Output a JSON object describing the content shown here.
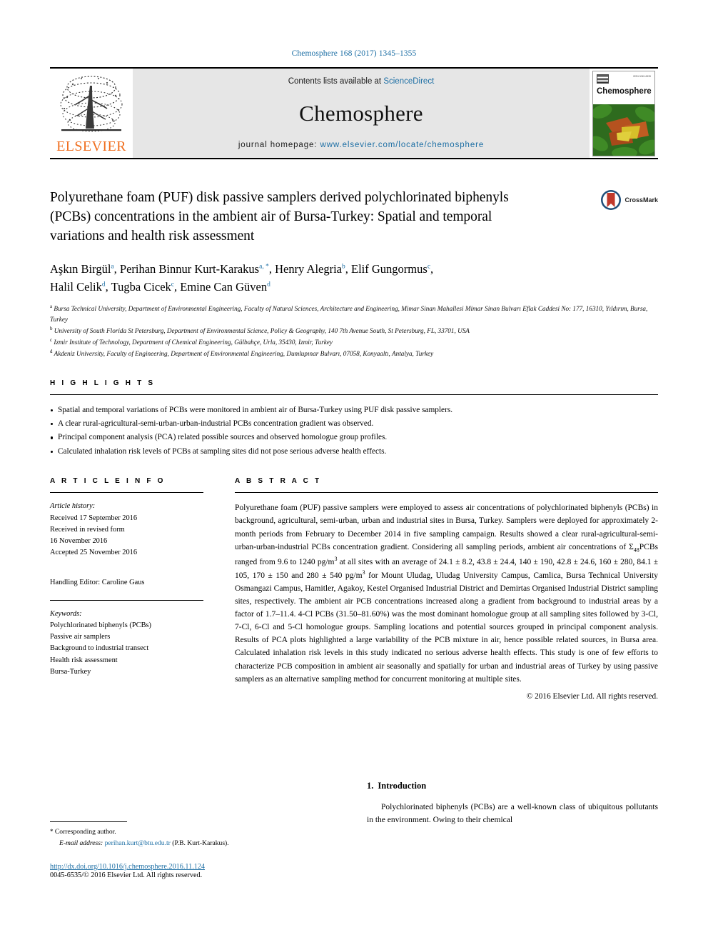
{
  "running_head": "Chemosphere 168 (2017) 1345–1355",
  "banner": {
    "publisher": "ELSEVIER",
    "contents_prefix": "Contents lists available at ",
    "sciencedirect": "ScienceDirect",
    "journal_name": "Chemosphere",
    "homepage_prefix": "journal homepage: ",
    "homepage_url": "www.elsevier.com/locate/chemosphere",
    "cover_title": "Chemosphere",
    "link_color": "#1c6ea4",
    "elsevier_orange": "#f06e1e"
  },
  "article": {
    "title": "Polyurethane foam (PUF) disk passive samplers derived polychlorinated biphenyls (PCBs) concentrations in the ambient air of Bursa-Turkey: Spatial and temporal variations and health risk assessment",
    "crossmark_label": "CrossMark",
    "authors_line1_parts": [
      {
        "name": "Aşkın Birgül",
        "sup": "a"
      },
      {
        "name": "Perihan Binnur Kurt-Karakus",
        "sup": "a, *"
      },
      {
        "name": "Henry Alegria",
        "sup": "b"
      },
      {
        "name": "Elif Gungormus",
        "sup": "c"
      }
    ],
    "authors_line2_parts": [
      {
        "name": "Halil Celik",
        "sup": "d"
      },
      {
        "name": "Tugba Cicek",
        "sup": "c"
      },
      {
        "name": "Emine Can Güven",
        "sup": "d"
      }
    ],
    "affiliations": [
      {
        "sup": "a",
        "text": "Bursa Technical University, Department of Environmental Engineering, Faculty of Natural Sciences, Architecture and Engineering, Mimar Sinan Mahallesi Mimar Sinan Bulvarı Eflak Caddesi No: 177, 16310, Yıldırım, Bursa, Turkey"
      },
      {
        "sup": "b",
        "text": "University of South Florida St Petersburg, Department of Environmental Science, Policy & Geography, 140 7th Avenue South, St Petersburg, FL, 33701, USA"
      },
      {
        "sup": "c",
        "text": "Izmir Institute of Technology, Department of Chemical Engineering, Gülbahçe, Urla, 35430, Izmir, Turkey"
      },
      {
        "sup": "d",
        "text": "Akdeniz University, Faculty of Engineering, Department of Environmental Engineering, Dumlupınar Bulvarı, 07058, Konyaaltı, Antalya, Turkey"
      }
    ]
  },
  "highlights": {
    "heading": "H I G H L I G H T S",
    "items": [
      "Spatial and temporal variations of PCBs were monitored in ambient air of Bursa-Turkey using PUF disk passive samplers.",
      "A clear rural-agricultural-semi-urban-urban-industrial PCBs concentration gradient was observed.",
      "Principal component analysis (PCA) related possible sources and observed homologue group profiles.",
      "Calculated inhalation risk levels of PCBs at sampling sites did not pose serious adverse health effects."
    ]
  },
  "article_info": {
    "heading": "A R T I C L E   I N F O",
    "history_label": "Article history:",
    "history_lines": [
      "Received 17 September 2016",
      "Received in revised form",
      "16 November 2016",
      "Accepted 25 November 2016"
    ],
    "handling_editor": "Handling Editor: Caroline Gaus",
    "keywords_label": "Keywords:",
    "keywords": [
      "Polychlorinated biphenyls (PCBs)",
      "Passive air samplers",
      "Background to industrial transect",
      "Health risk assessment",
      "Bursa-Turkey"
    ]
  },
  "abstract": {
    "heading": "A B S T R A C T",
    "part1": "Polyurethane foam (PUF) passive samplers were employed to assess air concentrations of polychlorinated biphenyls (PCBs) in background, agricultural, semi-urban, urban and industrial sites in Bursa, Turkey. Samplers were deployed for approximately 2-month periods from February to December 2014 in five sampling campaign. Results showed a clear rural-agricultural-semi-urban-urban-industrial PCBs concentration gradient. Considering all sampling periods, ambient air concentrations of Σ",
    "sigma_sub": "48",
    "part2": "PCBs ranged from 9.6 to 1240 pg/m",
    "sup1": "3",
    "part3": " at all sites with an average of 24.1 ± 8.2, 43.8 ± 24.4, 140 ± 190, 42.8 ± 24.6, 160 ± 280, 84.1 ± 105, 170 ± 150 and 280 ± 540 pg/m",
    "sup2": "3",
    "part4": " for Mount Uludag, Uludag University Campus, Camlica, Bursa Technical University Osmangazi Campus, Hamitler, Agakoy, Kestel Organised Industrial District and Demirtas Organised Industrial District sampling sites, respectively. The ambient air PCB concentrations increased along a gradient from background to industrial areas by a factor of 1.7–11.4. 4-Cl PCBs (31.50–81.60%) was the most dominant homologue group at all sampling sites followed by 3-Cl, 7-Cl, 6-Cl and 5-Cl homologue groups. Sampling locations and potential sources grouped in principal component analysis. Results of PCA plots highlighted a large variability of the PCB mixture in air, hence possible related sources, in Bursa area. Calculated inhalation risk levels in this study indicated no serious adverse health effects. This study is one of few efforts to characterize PCB composition in ambient air seasonally and spatially for urban and industrial areas of Turkey by using passive samplers as an alternative sampling method for concurrent monitoring at multiple sites.",
    "copyright": "© 2016 Elsevier Ltd. All rights reserved."
  },
  "footer": {
    "corresponding_label": "Corresponding author.",
    "email_label": "E-mail address:",
    "email": "perihan.kurt@btu.edu.tr",
    "email_owner": "(P.B. Kurt-Karakus).",
    "doi_url": "http://dx.doi.org/10.1016/j.chemosphere.2016.11.124",
    "issn_line": "0045-6535/© 2016 Elsevier Ltd. All rights reserved."
  },
  "introduction": {
    "number": "1.",
    "heading": "Introduction",
    "body": "Polychlorinated biphenyls (PCBs) are a well-known class of ubiquitous pollutants in the environment. Owing to their chemical"
  }
}
